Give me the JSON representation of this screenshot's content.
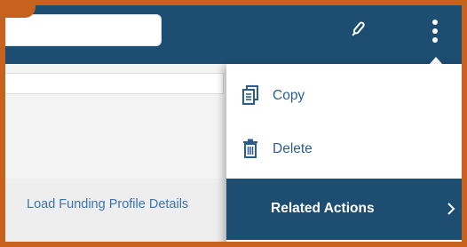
{
  "header": {
    "search": {
      "value": ""
    },
    "actions": [
      "pencil-icon",
      "more-vertical-icon"
    ]
  },
  "sidebar_link": {
    "label": "Load Funding Profile Details"
  },
  "menu": {
    "items": [
      {
        "label": "Copy",
        "icon": "copy-icon"
      },
      {
        "label": "Delete",
        "icon": "trash-icon"
      },
      {
        "label": "Related Actions",
        "icon": "chevron-right-icon"
      }
    ]
  },
  "colors": {
    "frame_border": "#c8611e",
    "header_bg": "#1e4d72",
    "menu_text": "#2b5e8f",
    "link_text": "#3a74b3",
    "selected_item_bg": "#1e4d72"
  }
}
